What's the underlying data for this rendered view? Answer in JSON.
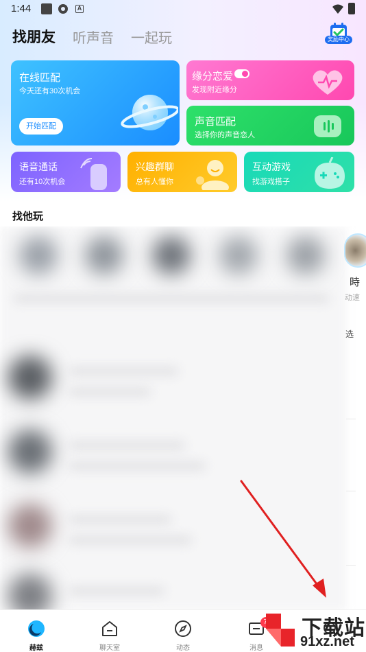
{
  "status_bar": {
    "time": "1:44"
  },
  "header": {
    "tabs": [
      "找朋友",
      "听声音",
      "一起玩"
    ],
    "reward_label": "奖励中心"
  },
  "cards": {
    "online_match": {
      "title": "在线匹配",
      "subtitle": "今天还有30次机会",
      "button": "开始匹配"
    },
    "love": {
      "title": "缘分恋爱",
      "subtitle": "发现附近缘分"
    },
    "voice_match": {
      "title": "声音匹配",
      "subtitle": "选择你的声音恋人"
    },
    "voice_call": {
      "title": "语音通话",
      "subtitle": "还有10次机会"
    },
    "group_chat": {
      "title": "兴趣群聊",
      "subtitle": "总有人懂你"
    },
    "games": {
      "title": "互动游戏",
      "subtitle": "找游戏搭子"
    }
  },
  "section": {
    "title": "找他玩"
  },
  "peek": {
    "name": "時",
    "sub": "动速",
    "select": "选"
  },
  "bottom_nav": {
    "items": [
      {
        "label": "赫兹"
      },
      {
        "label": "聊天室"
      },
      {
        "label": "动态"
      },
      {
        "label": "消息"
      },
      {
        "label": ""
      }
    ],
    "message_badge": "75"
  },
  "watermark": {
    "line1": "下载站",
    "line2": "91xz.net"
  },
  "colors": {
    "online": "#1a8dff",
    "love": "#ff48b0",
    "voice": "#18c75a",
    "call": "#7d63ff",
    "group": "#ffb000",
    "game": "#18d9b8",
    "badge": "#ff3b4e",
    "arrow": "#e02020"
  }
}
